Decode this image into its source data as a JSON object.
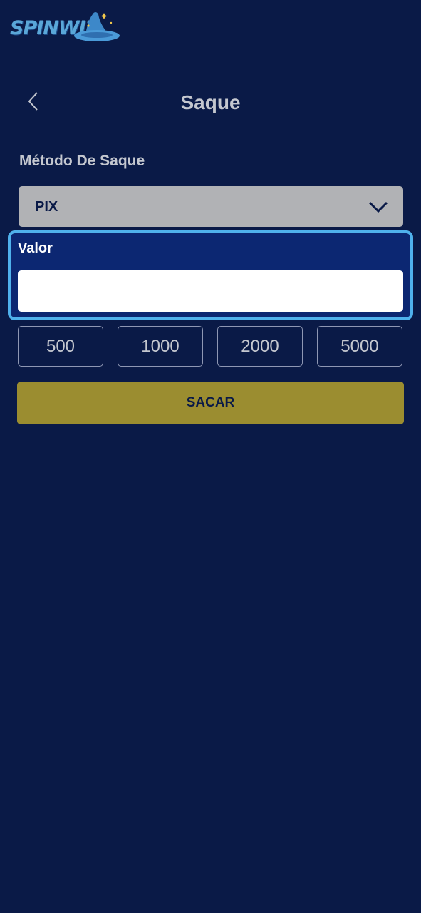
{
  "brand": {
    "logo_text": "SPINWIZ"
  },
  "page": {
    "title": "Saque",
    "back_icon": "chevron-left-icon"
  },
  "withdraw_method": {
    "label": "Método De Saque",
    "selected": "PIX",
    "chevron_icon": "chevron-down-icon"
  },
  "amount_field": {
    "label": "Valor",
    "value": "",
    "placeholder": ""
  },
  "quick_amounts": [
    "500",
    "1000",
    "2000",
    "5000"
  ],
  "submit": {
    "label": "SACAR"
  },
  "colors": {
    "background": "#0a1a47",
    "select_bg": "#b1b2b5",
    "focus_border": "#4fb1ec",
    "field_group_bg": "#0c2772",
    "submit_bg": "#9b8d30",
    "muted_text": "#c4c7cf"
  }
}
